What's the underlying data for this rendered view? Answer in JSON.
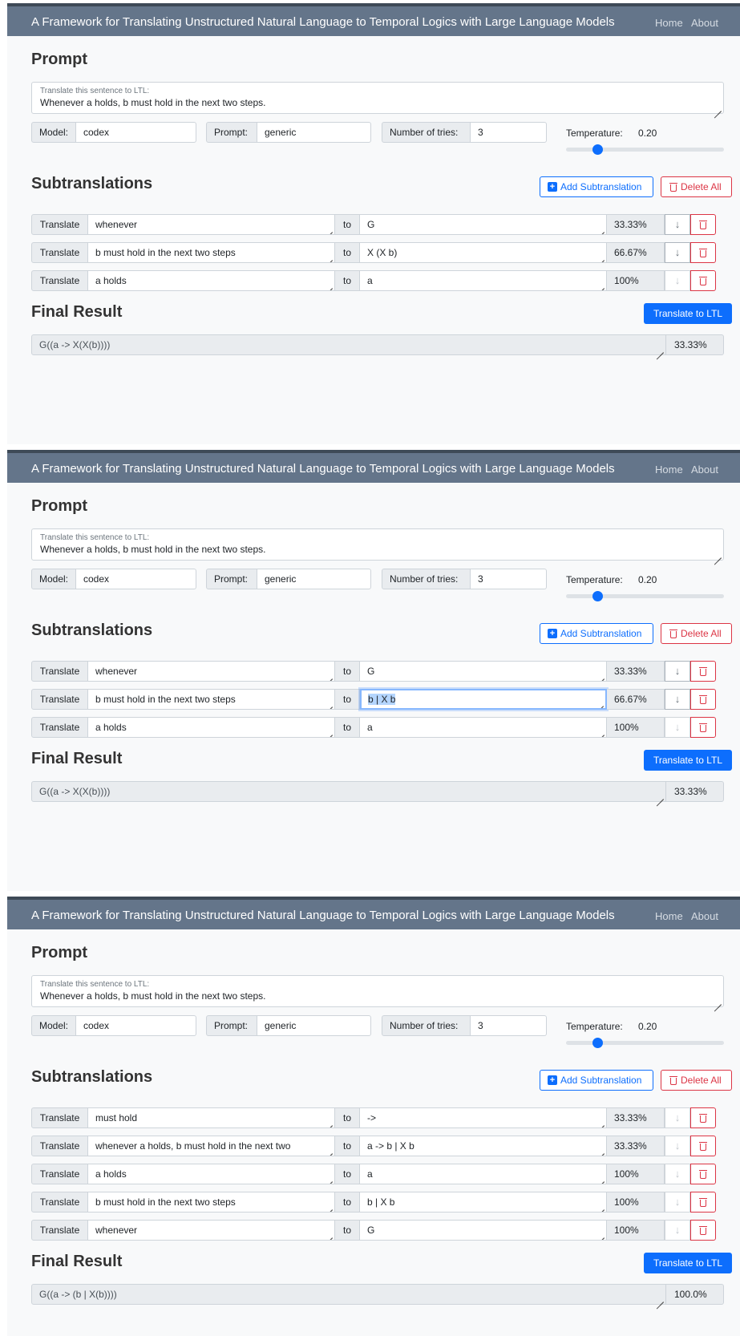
{
  "panels": [
    {
      "navbar": {
        "title": "A Framework for Translating Unstructured Natural Language to Temporal Logics with Large Language Models",
        "home": "Home",
        "about": "About"
      },
      "prompt_heading": "Prompt",
      "prompt_label": "Translate this sentence to LTL:",
      "prompt_text": "Whenever a holds, b must hold in the next two steps.",
      "model_label": "Model:",
      "model_value": "codex",
      "prompt_type_label": "Prompt:",
      "prompt_type_value": "generic",
      "tries_label": "Number of tries:",
      "tries_value": "3",
      "temperature_label": "Temperature:",
      "temperature_value": "0.20",
      "temperature_fraction": 0.2,
      "subtranslations_heading": "Subtranslations",
      "add_button": "Add Subtranslation",
      "delete_all_button": "Delete All",
      "rows": [
        {
          "translate": "Translate",
          "source": "whenever",
          "to": "to",
          "target": "G",
          "confidence": "33.33%",
          "down": "↓"
        },
        {
          "translate": "Translate",
          "source": "b must hold in the next two steps",
          "to": "to",
          "target": "X (X b)",
          "confidence": "66.67%",
          "down": "↓"
        },
        {
          "translate": "Translate",
          "source": "a holds",
          "to": "to",
          "target": "a",
          "confidence": "100%",
          "down": "↓"
        }
      ],
      "final_heading": "Final Result",
      "translate_button": "Translate to LTL",
      "final_value": "G((a -> X(X(b))))",
      "final_confidence": "33.33%"
    },
    {
      "navbar": {
        "title": "A Framework for Translating Unstructured Natural Language to Temporal Logics with Large Language Models",
        "home": "Home",
        "about": "About"
      },
      "prompt_heading": "Prompt",
      "prompt_label": "Translate this sentence to LTL:",
      "prompt_text": "Whenever a holds, b must hold in the next two steps.",
      "model_label": "Model:",
      "model_value": "codex",
      "prompt_type_label": "Prompt:",
      "prompt_type_value": "generic",
      "tries_label": "Number of tries:",
      "tries_value": "3",
      "temperature_label": "Temperature:",
      "temperature_value": "0.20",
      "temperature_fraction": 0.2,
      "subtranslations_heading": "Subtranslations",
      "add_button": "Add Subtranslation",
      "delete_all_button": "Delete All",
      "rows": [
        {
          "translate": "Translate",
          "source": "whenever",
          "to": "to",
          "target": "G",
          "confidence": "33.33%",
          "down": "↓"
        },
        {
          "translate": "Translate",
          "source": "b must hold in the next two steps",
          "to": "to",
          "target": "b | X b",
          "confidence": "66.67%",
          "down": "↓",
          "focused": true
        },
        {
          "translate": "Translate",
          "source": "a holds",
          "to": "to",
          "target": "a",
          "confidence": "100%",
          "down": "↓"
        }
      ],
      "final_heading": "Final Result",
      "translate_button": "Translate to LTL",
      "final_value": "G((a -> X(X(b))))",
      "final_confidence": "33.33%"
    },
    {
      "navbar": {
        "title": "A Framework for Translating Unstructured Natural Language to Temporal Logics with Large Language Models",
        "home": "Home",
        "about": "About"
      },
      "prompt_heading": "Prompt",
      "prompt_label": "Translate this sentence to LTL:",
      "prompt_text": "Whenever a holds, b must hold in the next two steps.",
      "model_label": "Model:",
      "model_value": "codex",
      "prompt_type_label": "Prompt:",
      "prompt_type_value": "generic",
      "tries_label": "Number of tries:",
      "tries_value": "3",
      "temperature_label": "Temperature:",
      "temperature_value": "0.20",
      "temperature_fraction": 0.2,
      "subtranslations_heading": "Subtranslations",
      "add_button": "Add Subtranslation",
      "delete_all_button": "Delete All",
      "rows": [
        {
          "translate": "Translate",
          "source": "must hold",
          "to": "to",
          "target": "->",
          "confidence": "33.33%",
          "down": "↓"
        },
        {
          "translate": "Translate",
          "source": "whenever a holds, b must hold in the next two",
          "to": "to",
          "target": "a -> b | X b",
          "confidence": "33.33%",
          "down": "↓"
        },
        {
          "translate": "Translate",
          "source": "a holds",
          "to": "to",
          "target": "a",
          "confidence": "100%",
          "down": "↓"
        },
        {
          "translate": "Translate",
          "source": "b must hold in the next two steps",
          "to": "to",
          "target": "b | X b",
          "confidence": "100%",
          "down": "↓"
        },
        {
          "translate": "Translate",
          "source": "whenever",
          "to": "to",
          "target": "G",
          "confidence": "100%",
          "down": "↓"
        }
      ],
      "final_heading": "Final Result",
      "translate_button": "Translate to LTL",
      "final_value": "G((a -> (b | X(b))))",
      "final_confidence": "100.0%"
    }
  ]
}
